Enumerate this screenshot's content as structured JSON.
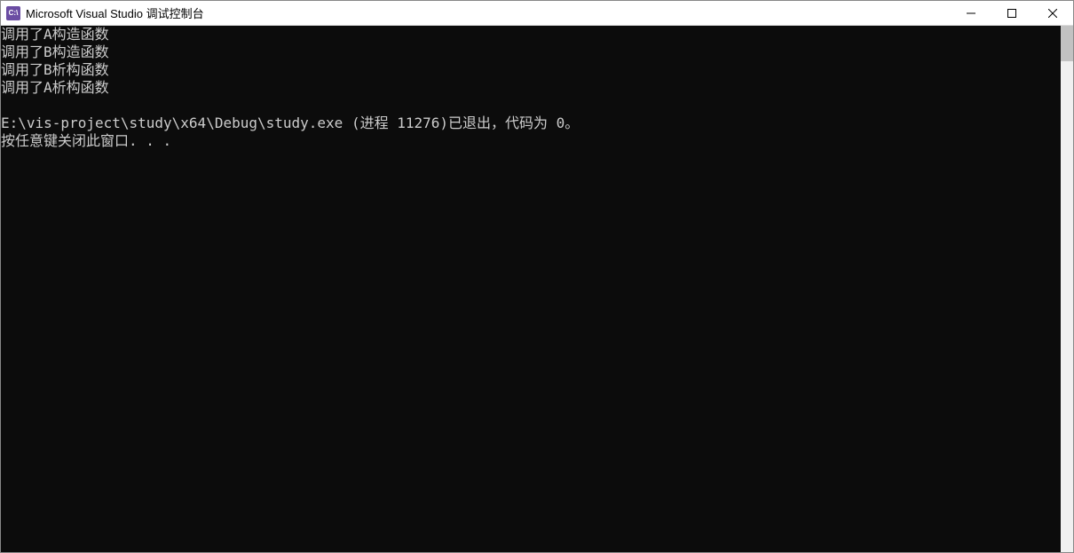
{
  "window": {
    "icon_text": "C:\\",
    "title": "Microsoft Visual Studio 调试控制台"
  },
  "console": {
    "lines": [
      "调用了A构造函数",
      "调用了B构造函数",
      "调用了B析构函数",
      "调用了A析构函数",
      "",
      "E:\\vis-project\\study\\x64\\Debug\\study.exe (进程 11276)已退出，代码为 0。",
      "按任意键关闭此窗口. . ."
    ]
  }
}
